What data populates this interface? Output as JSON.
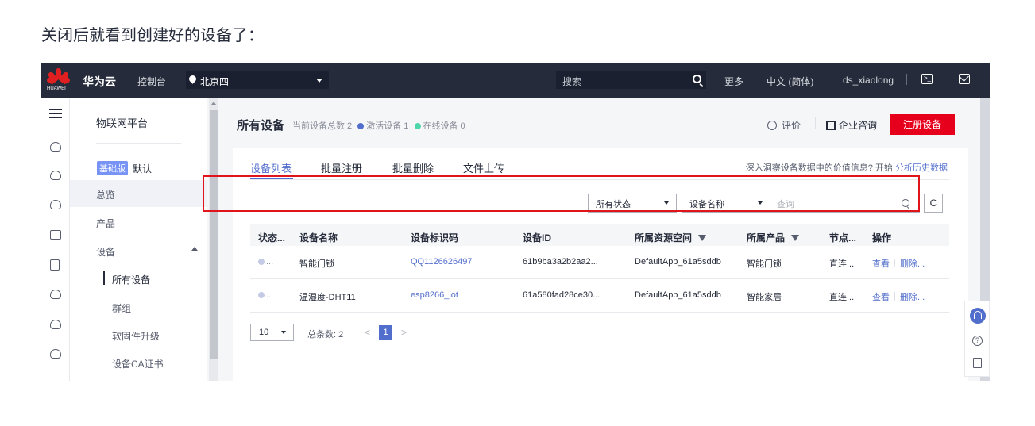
{
  "caption": "关闭后就看到创建好的设备了：",
  "topbar": {
    "logo_text": "HUAWEI",
    "brand": "华为云",
    "console": "控制台",
    "region": "北京四",
    "search_placeholder": "搜索",
    "more": "更多",
    "language": "中文 (简体)",
    "user": "ds_xiaolong"
  },
  "nav": {
    "title": "物联网平台",
    "edition_badge": "基础版",
    "edition_default": "默认",
    "items": {
      "overview": "总览",
      "product": "产品",
      "device": "设备"
    },
    "sub_items": {
      "all_devices": "所有设备",
      "group": "群组",
      "firmware": "软固件升级",
      "ca_cert": "设备CA证书"
    }
  },
  "header": {
    "title": "所有设备",
    "total_label": "当前设备总数 2",
    "active_label": "激活设备 1",
    "online_label": "在线设备 0",
    "rate": "评价",
    "consult": "企业咨询",
    "register_button": "注册设备",
    "colors": {
      "active": "#526ecc",
      "online": "#50d4ab",
      "primary": "#e6001c"
    }
  },
  "tabs": [
    "设备列表",
    "批量注册",
    "批量删除",
    "文件上传"
  ],
  "insight": {
    "text": "深入洞察设备数据中的价值信息? 开始",
    "link": "分析历史数据"
  },
  "filters": {
    "status": "所有状态",
    "field": "设备名称",
    "query_placeholder": "查询"
  },
  "table": {
    "columns": [
      "状态...",
      "设备名称",
      "设备标识码",
      "设备ID",
      "所属资源空间",
      "所属产品",
      "节点...",
      "操作"
    ],
    "rows": [
      {
        "status": "...",
        "name": "智能门锁",
        "identifier": "QQ1126626497",
        "device_id": "61b9ba3a2b2aa2...",
        "space": "DefaultApp_61a5sddb",
        "product": "智能门锁",
        "node": "直连...",
        "view": "查看",
        "delete": "删除..."
      },
      {
        "status": "...",
        "name": "温湿度-DHT11",
        "identifier": "esp8266_iot",
        "device_id": "61a580fad28ce30...",
        "space": "DefaultApp_61a5sddb",
        "product": "智能家居",
        "node": "直连...",
        "view": "查看",
        "delete": "删除..."
      }
    ]
  },
  "pager": {
    "page_size": "10",
    "total": "总条数: 2",
    "current_page": "1",
    "prev": "<",
    "next": ">"
  },
  "float": {
    "help": "?"
  }
}
